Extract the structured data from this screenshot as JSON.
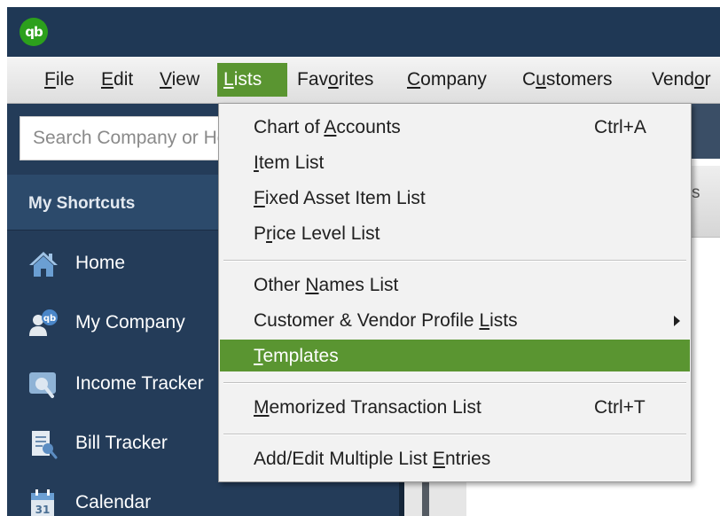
{
  "app": {
    "logo_text": "qb",
    "brand_color": "#2ca01c"
  },
  "menubar": {
    "items": [
      {
        "pre": "",
        "mn": "F",
        "post": "ile"
      },
      {
        "pre": "",
        "mn": "E",
        "post": "dit"
      },
      {
        "pre": "",
        "mn": "V",
        "post": "iew"
      },
      {
        "pre": "",
        "mn": "L",
        "post": "ists"
      },
      {
        "pre": "Fav",
        "mn": "o",
        "post": "rites"
      },
      {
        "pre": "",
        "mn": "C",
        "post": "ompany"
      },
      {
        "pre": "C",
        "mn": "u",
        "post": "stomers"
      },
      {
        "pre": "Vend",
        "mn": "o",
        "post": "r"
      }
    ],
    "active_index": 3,
    "active_color": "#5a9531"
  },
  "sidebar": {
    "search_placeholder": "Search Company or Help",
    "shortcuts_title": "My Shortcuts",
    "items": [
      {
        "label": "Home",
        "icon": "home-icon"
      },
      {
        "label": "My Company",
        "icon": "my-company-icon"
      },
      {
        "label": "Income Tracker",
        "icon": "income-tracker-icon"
      },
      {
        "label": "Bill Tracker",
        "icon": "bill-tracker-icon"
      },
      {
        "label": "Calendar",
        "icon": "calendar-icon"
      }
    ],
    "calendar_day": "31"
  },
  "content": {
    "tab_text": "s"
  },
  "lists_menu": {
    "items": [
      {
        "pre": "Chart of ",
        "mn": "A",
        "post": "ccounts",
        "shortcut": "Ctrl+A"
      },
      {
        "pre": "",
        "mn": "I",
        "post": "tem List",
        "shortcut": ""
      },
      {
        "pre": "",
        "mn": "F",
        "post": "ixed Asset Item List",
        "shortcut": ""
      },
      {
        "pre": "P",
        "mn": "r",
        "post": "ice Level List",
        "shortcut": ""
      },
      {
        "pre": "Other ",
        "mn": "N",
        "post": "ames List",
        "shortcut": ""
      },
      {
        "pre": "Customer & Vendor Profile ",
        "mn": "L",
        "post": "ists",
        "shortcut": "",
        "submenu": true
      },
      {
        "pre": "",
        "mn": "T",
        "post": "emplates",
        "shortcut": ""
      },
      {
        "pre": "",
        "mn": "M",
        "post": "emorized Transaction List",
        "shortcut": "Ctrl+T"
      },
      {
        "pre": "Add/Edit Multiple List ",
        "mn": "E",
        "post": "ntries",
        "shortcut": ""
      }
    ],
    "selected_index": 6,
    "highlight_color": "#5a9531"
  }
}
